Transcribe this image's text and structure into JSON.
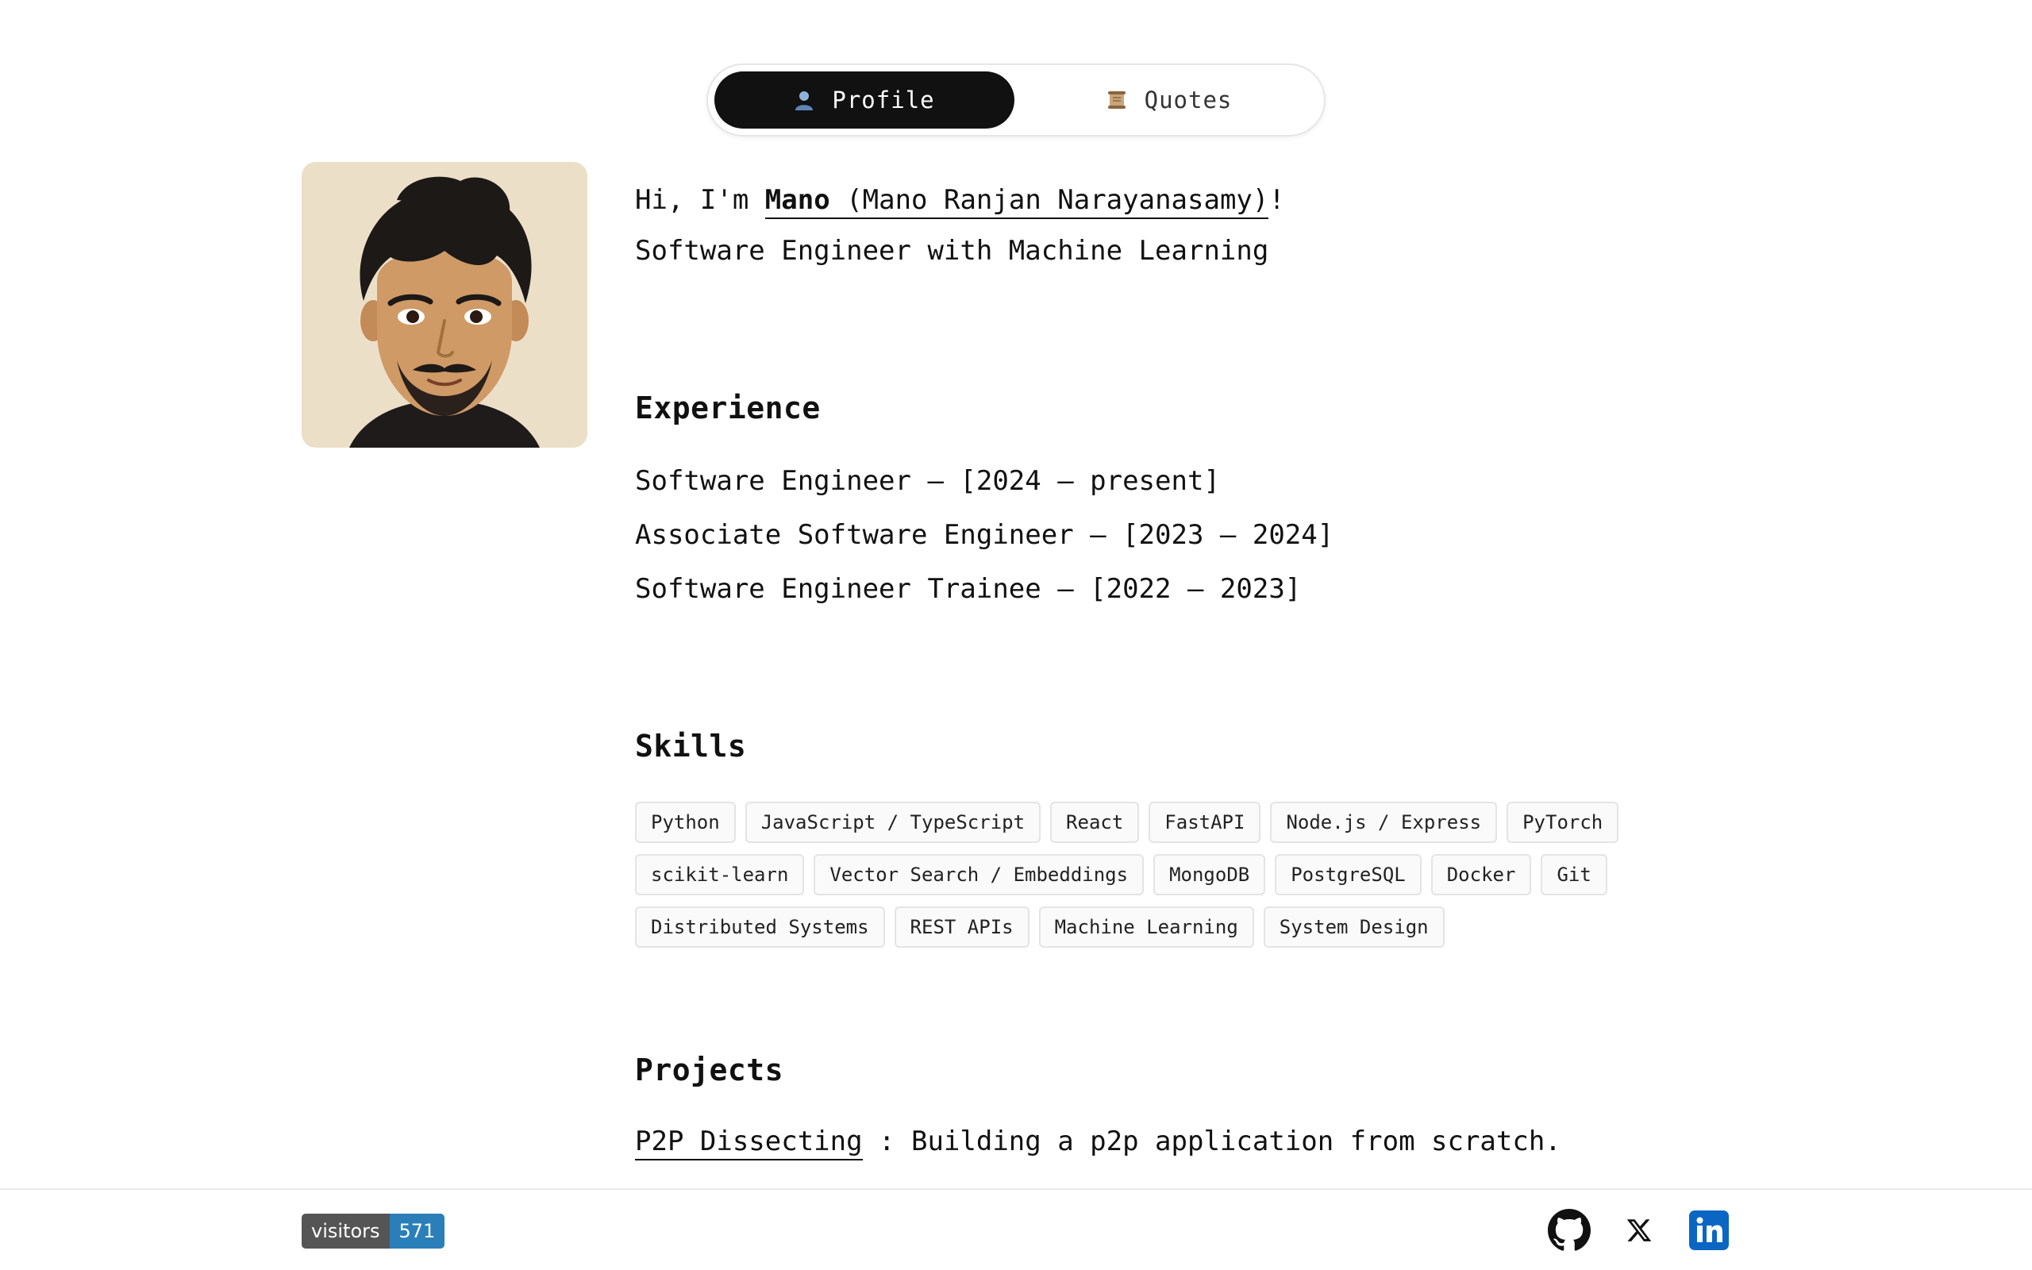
{
  "tabs": [
    {
      "label": "Profile",
      "icon": "person-icon",
      "active": true
    },
    {
      "label": "Quotes",
      "icon": "scroll-icon",
      "active": false
    }
  ],
  "intro": {
    "greeting": "Hi, I'm",
    "short_name": "Mano",
    "full_name": "(Mano Ranjan Narayanasamy)",
    "exclaim": "!",
    "tagline": "Software Engineer with Machine Learning"
  },
  "experience": {
    "title": "Experience",
    "items": [
      "Software Engineer – [2024 – present]",
      "Associate Software Engineer – [2023 – 2024]",
      "Software Engineer Trainee – [2022 – 2023]"
    ]
  },
  "skills": {
    "title": "Skills",
    "rows": [
      [
        "Python",
        "JavaScript / TypeScript",
        "React",
        "FastAPI",
        "Node.js / Express",
        "PyTorch"
      ],
      [
        "scikit-learn",
        "Vector Search / Embeddings",
        "MongoDB",
        "PostgreSQL",
        "Docker",
        "Git"
      ],
      [
        "Distributed Systems",
        "REST APIs",
        "Machine Learning",
        "System Design"
      ]
    ]
  },
  "projects": {
    "title": "Projects",
    "items": [
      {
        "name": "P2P Dissecting",
        "desc": " : Building a p2p application from scratch."
      }
    ]
  },
  "footer": {
    "visitors_label": "visitors",
    "visitors_count": "571",
    "social": [
      "github-icon",
      "x-icon",
      "linkedin-icon"
    ]
  },
  "colors": {
    "tab_active_bg": "#111111",
    "badge_label_bg": "#555555",
    "badge_count_bg": "#2a7fb8",
    "linkedin_blue": "#0a66c2"
  }
}
